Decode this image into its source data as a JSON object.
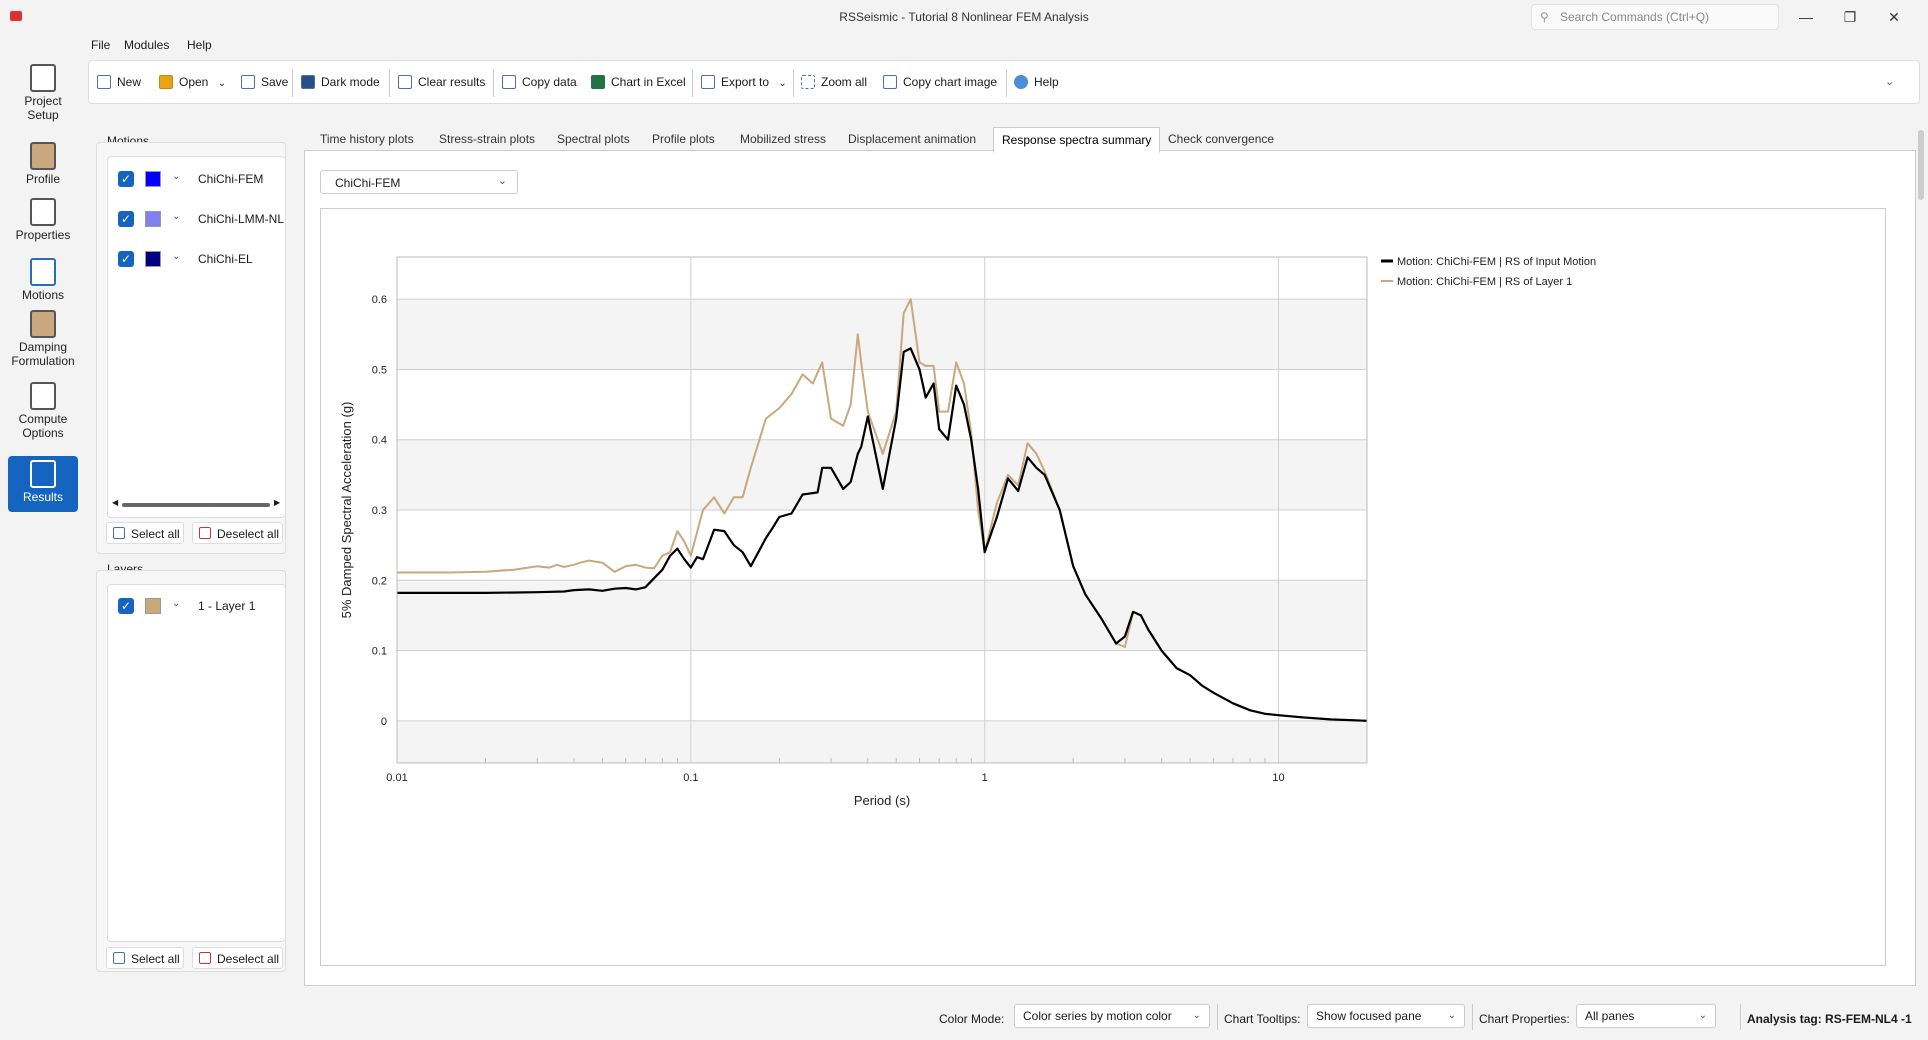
{
  "window": {
    "title": "RSSeismic - Tutorial 8 Nonlinear FEM Analysis",
    "search_placeholder": "Search Commands (Ctrl+Q)"
  },
  "rail": [
    {
      "label1": "Project",
      "label2": "Setup"
    },
    {
      "label1": "Profile",
      "label2": ""
    },
    {
      "label1": "Properties",
      "label2": ""
    },
    {
      "label1": "Motions",
      "label2": ""
    },
    {
      "label1": "Damping",
      "label2": "Formulation"
    },
    {
      "label1": "Compute",
      "label2": "Options"
    },
    {
      "label1": "Results",
      "label2": ""
    }
  ],
  "menu": [
    "File",
    "Modules",
    "Help"
  ],
  "toolbar": {
    "new": "New",
    "open": "Open",
    "save": "Save",
    "dark_mode": "Dark mode",
    "clear_results": "Clear results",
    "copy_data": "Copy data",
    "chart_in_excel": "Chart in Excel",
    "export_to": "Export to",
    "zoom_all": "Zoom all",
    "copy_chart_image": "Copy chart image",
    "help": "Help"
  },
  "motions_panel": {
    "title": "Motions",
    "items": [
      {
        "label": "ChiChi-FEM",
        "color": "#0000ff"
      },
      {
        "label": "ChiChi-LMM-NL",
        "color": "#8080f0"
      },
      {
        "label": "ChiChi-EL",
        "color": "#000080"
      }
    ],
    "select_all": "Select all",
    "deselect_all": "Deselect all"
  },
  "layers_panel": {
    "title": "Layers",
    "items": [
      {
        "label": "1 - Layer 1",
        "color": "#c8a87c"
      }
    ],
    "select_all": "Select all",
    "deselect_all": "Deselect all"
  },
  "tabs": [
    "Time history plots",
    "Stress-strain plots",
    "Spectral plots",
    "Profile plots",
    "Mobilized stress",
    "Displacement animation",
    "Response spectra summary",
    "Check convergence"
  ],
  "active_tab": "Response spectra summary",
  "motion_selector": "ChiChi-FEM",
  "statusbar": {
    "color_mode_label": "Color Mode:",
    "color_mode_value": "Color series by motion color",
    "tooltips_label": "Chart Tooltips:",
    "tooltips_value": "Show focused pane",
    "properties_label": "Chart Properties:",
    "properties_value": "All panes",
    "analysis_tag": "Analysis tag: RS-FEM-NL4 -1"
  },
  "chart_data": {
    "type": "line",
    "xlabel": "Period (s)",
    "ylabel": "5% Damped Spectral Acceleration (g)",
    "xscale": "log",
    "xlim": [
      0.01,
      20
    ],
    "ylim": [
      -0.06,
      0.66
    ],
    "xticks": [
      "0.01",
      "0.1",
      "1",
      "10"
    ],
    "yticks": [
      "0",
      "0.1",
      "0.2",
      "0.3",
      "0.4",
      "0.5",
      "0.6"
    ],
    "legend_position": "top-right",
    "series": [
      {
        "name": "Motion: ChiChi-FEM | RS of Input Motion",
        "color": "#000000",
        "x": [
          0.01,
          0.015,
          0.02,
          0.03,
          0.037,
          0.04,
          0.045,
          0.05,
          0.055,
          0.06,
          0.065,
          0.07,
          0.08,
          0.085,
          0.09,
          0.095,
          0.1,
          0.105,
          0.11,
          0.12,
          0.13,
          0.14,
          0.15,
          0.16,
          0.18,
          0.19,
          0.2,
          0.22,
          0.24,
          0.25,
          0.27,
          0.28,
          0.3,
          0.33,
          0.35,
          0.37,
          0.38,
          0.4,
          0.45,
          0.5,
          0.53,
          0.56,
          0.6,
          0.63,
          0.67,
          0.7,
          0.75,
          0.8,
          0.85,
          0.9,
          0.95,
          1.0,
          1.1,
          1.2,
          1.3,
          1.4,
          1.5,
          1.6,
          1.8,
          2.0,
          2.2,
          2.5,
          2.8,
          3.0,
          3.2,
          3.4,
          3.6,
          4.0,
          4.5,
          5,
          5.5,
          6,
          7,
          8,
          9,
          10,
          12,
          15,
          20
        ],
        "y": [
          0.182,
          0.182,
          0.182,
          0.183,
          0.184,
          0.186,
          0.187,
          0.185,
          0.188,
          0.189,
          0.187,
          0.19,
          0.215,
          0.235,
          0.245,
          0.23,
          0.218,
          0.233,
          0.23,
          0.272,
          0.27,
          0.25,
          0.24,
          0.22,
          0.26,
          0.275,
          0.29,
          0.295,
          0.322,
          0.323,
          0.325,
          0.36,
          0.36,
          0.33,
          0.34,
          0.38,
          0.39,
          0.433,
          0.33,
          0.43,
          0.525,
          0.53,
          0.5,
          0.46,
          0.48,
          0.415,
          0.4,
          0.477,
          0.45,
          0.4,
          0.33,
          0.24,
          0.29,
          0.345,
          0.327,
          0.375,
          0.36,
          0.35,
          0.3,
          0.22,
          0.18,
          0.145,
          0.11,
          0.12,
          0.155,
          0.15,
          0.13,
          0.1,
          0.075,
          0.065,
          0.05,
          0.04,
          0.025,
          0.015,
          0.01,
          0.008,
          0.005,
          0.002,
          0.0
        ]
      },
      {
        "name": "Motion: ChiChi-FEM | RS of Layer 1",
        "color": "#c8a87c",
        "x": [
          0.01,
          0.015,
          0.02,
          0.025,
          0.03,
          0.033,
          0.035,
          0.037,
          0.04,
          0.042,
          0.045,
          0.05,
          0.055,
          0.06,
          0.065,
          0.07,
          0.075,
          0.08,
          0.085,
          0.09,
          0.095,
          0.1,
          0.11,
          0.12,
          0.13,
          0.14,
          0.15,
          0.16,
          0.18,
          0.2,
          0.22,
          0.24,
          0.26,
          0.28,
          0.3,
          0.33,
          0.35,
          0.37,
          0.38,
          0.4,
          0.45,
          0.5,
          0.53,
          0.56,
          0.6,
          0.63,
          0.67,
          0.7,
          0.75,
          0.8,
          0.85,
          0.9,
          0.95,
          1.0,
          1.1,
          1.2,
          1.3,
          1.4,
          1.5,
          1.6,
          1.8,
          2.0,
          2.2,
          2.5,
          2.8,
          3.0,
          3.2,
          3.4,
          3.6,
          4.0,
          4.5,
          5,
          5.5,
          6,
          7,
          8,
          9,
          10,
          12,
          15,
          20
        ],
        "y": [
          0.211,
          0.211,
          0.212,
          0.215,
          0.22,
          0.218,
          0.222,
          0.219,
          0.222,
          0.225,
          0.228,
          0.225,
          0.212,
          0.22,
          0.222,
          0.218,
          0.217,
          0.235,
          0.24,
          0.27,
          0.255,
          0.235,
          0.3,
          0.318,
          0.295,
          0.318,
          0.318,
          0.36,
          0.43,
          0.445,
          0.465,
          0.493,
          0.48,
          0.51,
          0.43,
          0.42,
          0.45,
          0.55,
          0.51,
          0.44,
          0.38,
          0.44,
          0.58,
          0.6,
          0.51,
          0.505,
          0.505,
          0.44,
          0.44,
          0.51,
          0.48,
          0.41,
          0.3,
          0.24,
          0.31,
          0.35,
          0.335,
          0.395,
          0.38,
          0.355,
          0.3,
          0.22,
          0.18,
          0.145,
          0.11,
          0.105,
          0.155,
          0.15,
          0.13,
          0.1,
          0.075,
          0.065,
          0.05,
          0.04,
          0.025,
          0.015,
          0.01,
          0.008,
          0.005,
          0.002,
          0.0
        ]
      }
    ]
  }
}
